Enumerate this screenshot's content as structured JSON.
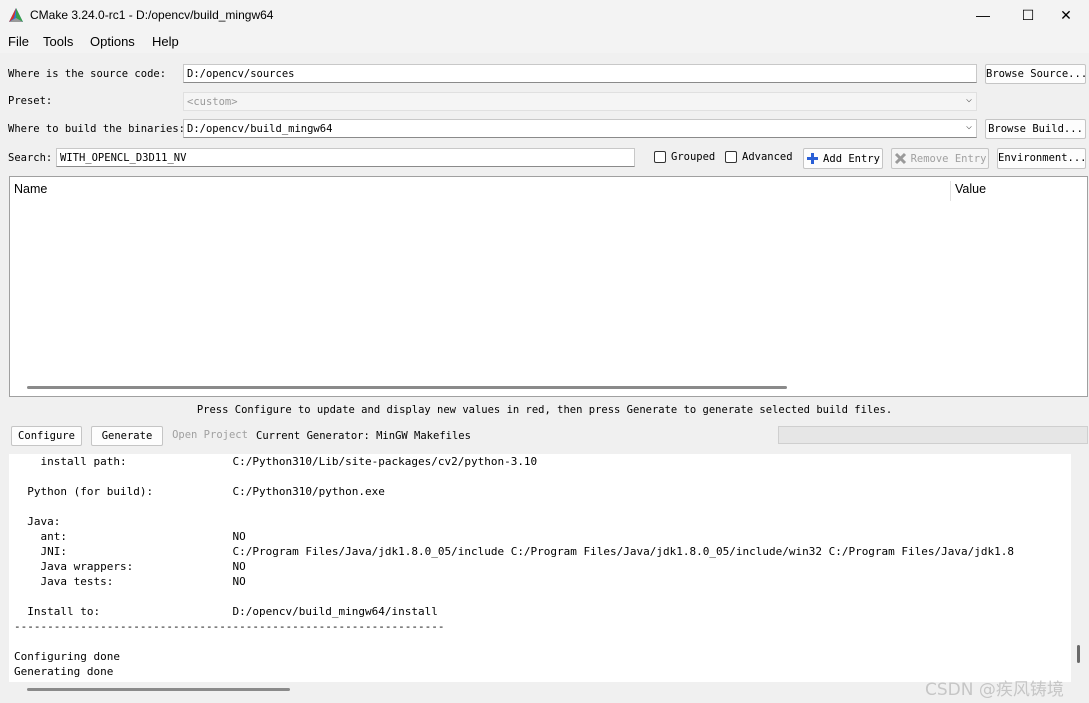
{
  "window": {
    "title": "CMake 3.24.0-rc1 - D:/opencv/build_mingw64",
    "minimize": "—",
    "maximize": "☐",
    "close": "✕"
  },
  "menu": [
    "File",
    "Tools",
    "Options",
    "Help"
  ],
  "source": {
    "label": "Where is the source code:",
    "value": "D:/opencv/sources",
    "button": "Browse Source..."
  },
  "preset": {
    "label": "Preset:",
    "value": "<custom>"
  },
  "binaries": {
    "label": "Where to build the binaries:",
    "value": "D:/opencv/build_mingw64",
    "button": "Browse Build..."
  },
  "search": {
    "label": "Search:",
    "value": "WITH_OPENCL_D3D11_NV",
    "grouped": "Grouped",
    "advanced": "Advanced",
    "add_entry": "Add Entry",
    "remove_entry": "Remove Entry",
    "environment": "Environment..."
  },
  "table": {
    "col_name": "Name",
    "col_value": "Value"
  },
  "status": "Press Configure to update and display new values in red, then press Generate to generate selected build files.",
  "actions": {
    "configure": "Configure",
    "generate": "Generate",
    "open_project": "Open Project",
    "generator": "Current Generator: MinGW Makefiles"
  },
  "output_lines": [
    "    install path:                C:/Python310/Lib/site-packages/cv2/python-3.10",
    "",
    "  Python (for build):            C:/Python310/python.exe",
    "",
    "  Java:",
    "    ant:                         NO",
    "    JNI:                         C:/Program Files/Java/jdk1.8.0_05/include C:/Program Files/Java/jdk1.8.0_05/include/win32 C:/Program Files/Java/jdk1.8",
    "    Java wrappers:               NO",
    "    Java tests:                  NO",
    "",
    "  Install to:                    D:/opencv/build_mingw64/install",
    "-----------------------------------------------------------------",
    "",
    "Configuring done",
    "Generating done"
  ],
  "watermark": "CSDN @疾风铸境",
  "colors": {
    "add_icon": "#2a5fd6",
    "remove_icon": "#9a9a9a"
  }
}
